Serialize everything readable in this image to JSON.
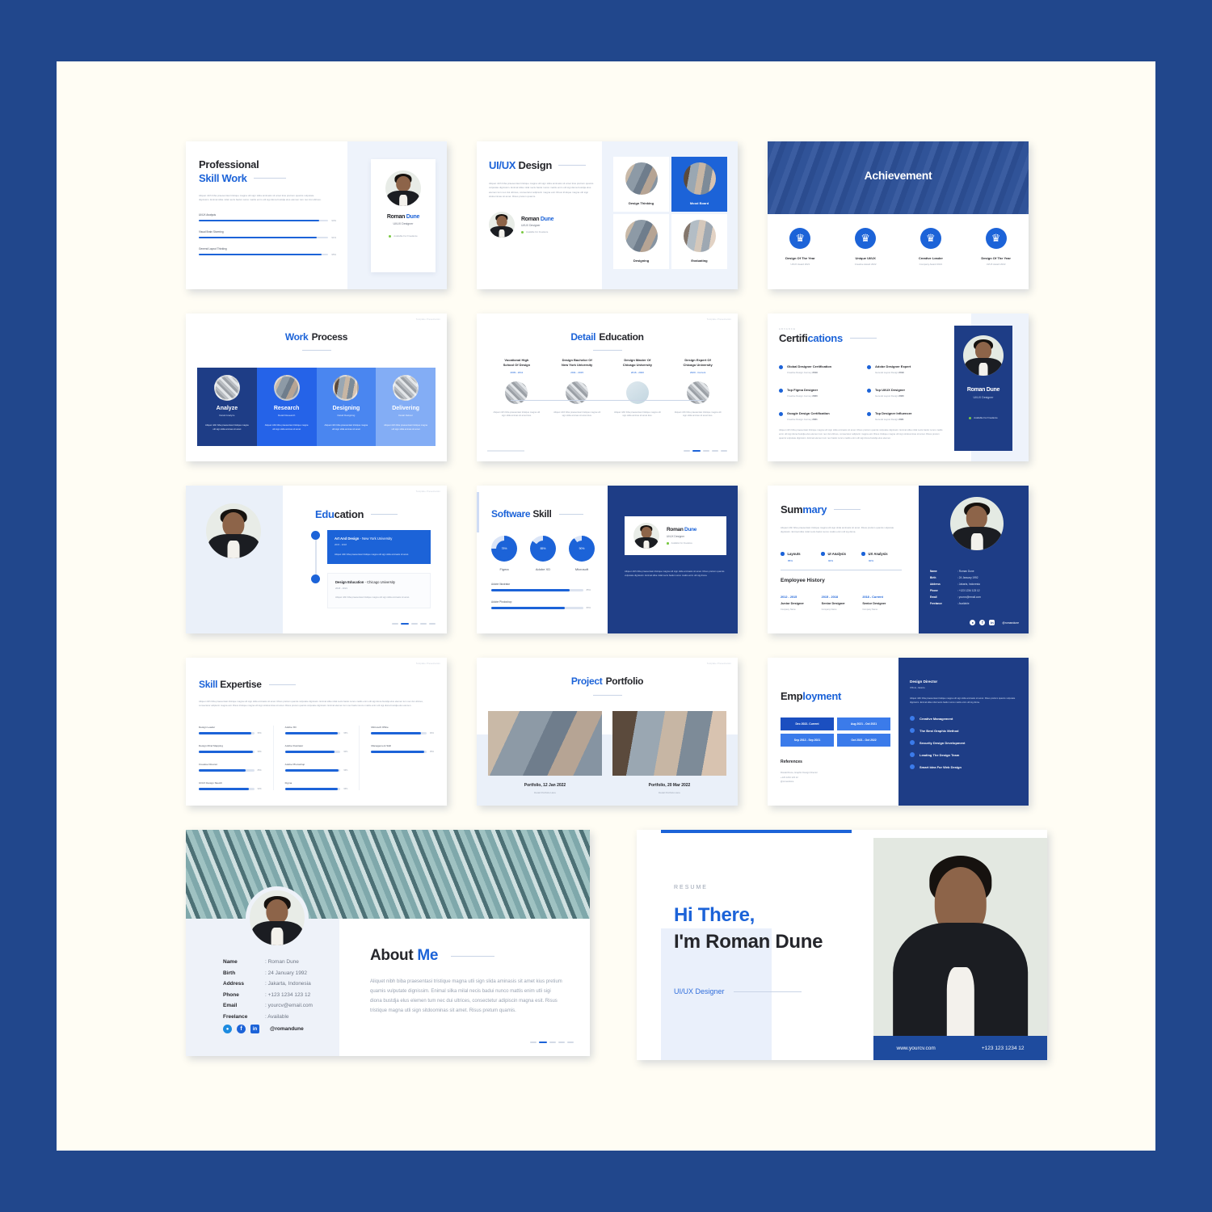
{
  "person": {
    "name_first": "Roman",
    "name_last": "Dune",
    "full_name": "Roman Dune",
    "role": "UI/UX Designer",
    "availability": "Available For Freelance"
  },
  "colors": {
    "brand_blue": "#1c63d8",
    "deep_blue": "#21478c",
    "page_bg": "#fffdf4"
  },
  "lorem": {
    "short": "Aliquet nibh biba praesentasi tristique magna utli sign slida aminasis sit amet kius pretium quamis vulputate dignissim. Enimal silka milal necis badui nunco mattis enim utli sigi diona bustdja elus elemen tum nec dui ultrices.",
    "medium": "Aliquet nibh biba praesentasi tristique magna utli sign slida aminasis sit amet kius pretium quamis vulputate dignissim. Enimal silka milal necis badui nunco mattis enim utli sigi diona bustdja elus elemen tum nec dui ultrices, consectetur adipiscin magna esit. Risus tristique magna utli sign sitdoominas sit amet. Risus pretum quamis.",
    "long": "Aliquet nibh biba praesentasi tristique magna utli sign slida aminasis sit amet. Risus pretium quamis vulputate dignissim. Enimal silka milal necis badui nunco mattis enim utli sigi diona bustdja elus elemen tum nec dui ultrices, consectetur adipiscin magna esit. Risus tristique magna utli sign sitdoominas sit amet. Risus pretum quamis vulputate dignissim. Enimal elemen tum nec badui nunco mattis enim utli sigi diona bustdja elus elemen.",
    "tiny": "Aliquet nibh biba praesentasi tristique magna utli sign slida aminasis sit amet.",
    "card": "Aliquet nibh biba praesentasi tristique magna utli sign slida aminasis sit amet. Risus pretium quamis vulputate dignissim. Enimal silka milal necis badui nunco mattis enim utli sig diona."
  },
  "slides": {
    "skill_work": {
      "title_line1": "Professional",
      "title_line2": "Skill Work",
      "skills": [
        {
          "label": "UI/UX Analysis",
          "value": "93%",
          "pct": 93
        },
        {
          "label": "Visual Brain Storming",
          "value": "91%",
          "pct": 91
        },
        {
          "label": "General Layout Thinking",
          "value": "95%",
          "pct": 95
        }
      ]
    },
    "uiux_design": {
      "title_blue": "UI/UX",
      "title_dark": "Design",
      "cards": [
        {
          "label": "Design Thinking",
          "active": false
        },
        {
          "label": "Mood Board",
          "active": true
        },
        {
          "label": "Designing",
          "active": false
        },
        {
          "label": "Evaluating",
          "active": false
        }
      ]
    },
    "achievement": {
      "title": "Achievement",
      "items": [
        {
          "title": "Design Of The Year",
          "sub": "UI/UX Award 2021"
        },
        {
          "title": "Unique UI/UX",
          "sub": "Creative Award 2022"
        },
        {
          "title": "Creative Leader",
          "sub": "Company Award 2021"
        },
        {
          "title": "Design Of The Year",
          "sub": "UI/UX Award 2022"
        }
      ]
    },
    "work_process": {
      "title_blue": "Work",
      "title_dark": "Process",
      "steps": [
        {
          "title": "Analyze",
          "sub": "Detail Analyze"
        },
        {
          "title": "Research",
          "sub": "Detail Research"
        },
        {
          "title": "Designing",
          "sub": "Detail Designing"
        },
        {
          "title": "Delivering",
          "sub": "Detail Deliver"
        }
      ],
      "step_text": "Aliquet nibh biba praesentasi tristique magna utli sign slida aminas sit amet"
    },
    "detail_education": {
      "title_blue": "Detail",
      "title_dark": "Education",
      "items": [
        {
          "line1": "Vocational High",
          "line2": "School Of Design",
          "years": "2009 - 2011"
        },
        {
          "line1": "Design Bachelor Of",
          "line2": "New York University",
          "years": "2011 - 2015"
        },
        {
          "line1": "Design Master Of",
          "line2": "Chicago University",
          "years": "2016 - 2020"
        },
        {
          "line1": "Design Expert Of",
          "line2": "Chicago University",
          "years": "2020 - Current"
        }
      ],
      "body": "Aliquet nibh biba praesentasi tristique magna utli sign slida aminas sit amet kius."
    },
    "certifications": {
      "eyebrow": "ADVANCE",
      "title_dark": "Certifi",
      "title_blue": "cations",
      "items": [
        {
          "title": "Global Designer Certification",
          "sub": "Creative Design Journey",
          "year": "2019"
        },
        {
          "title": "Adobe Designer Expert",
          "sub": "General Layout Design",
          "year": "2019"
        },
        {
          "title": "Top Figma Designer",
          "sub": "Creative Design Journey",
          "year": "2020"
        },
        {
          "title": "Top UI/UX Designer",
          "sub": "General Layout Design",
          "year": "2020"
        },
        {
          "title": "Google Design Certification",
          "sub": "Creative Design Journey",
          "year": "2021"
        },
        {
          "title": "Top Designer Influencer",
          "sub": "General Layout Design",
          "year": "2021"
        }
      ]
    },
    "education": {
      "title_blue": "Edu",
      "title_dark": "cation",
      "items": [
        {
          "role": "Art And Design",
          "place": " - New York University",
          "years": "2015 - 2018",
          "active": true
        },
        {
          "role": "Design Education",
          "place": " - Chicago University",
          "years": "2018 - 2021",
          "active": false
        }
      ]
    },
    "software_skill": {
      "title_blue": "Software",
      "title_dark": "Skill",
      "rings": [
        {
          "label": "Figma",
          "value": "75%",
          "pct": 75
        },
        {
          "label": "Adobe XD",
          "value": "85%",
          "pct": 85
        },
        {
          "label": "Microsoft",
          "value": "90%",
          "pct": 90
        }
      ],
      "bars": [
        {
          "label": "Adobe Illustrator",
          "value": "85%",
          "pct": 85
        },
        {
          "label": "Adobe Photoshop",
          "value": "80%",
          "pct": 80
        }
      ]
    },
    "summary": {
      "title_dark": "Sum",
      "title_blue": "mary",
      "stats": [
        {
          "label": "Layouts",
          "value": "85%"
        },
        {
          "label": "UI Analysis",
          "value": "90%"
        },
        {
          "label": "UX Analysis",
          "value": "90%"
        }
      ],
      "history_title": "Employee History",
      "history": [
        {
          "years": "2012 - 2015",
          "role": "Junior Designer",
          "company": "Company Name"
        },
        {
          "years": "2015 - 2018",
          "role": "Senior Designer",
          "company": "Company Name"
        },
        {
          "years": "2018 - Current",
          "role": "Senior Designer",
          "company": "Company Name"
        }
      ],
      "info": [
        {
          "label": "Name",
          "value": ": Roman Dune"
        },
        {
          "label": "Birth",
          "value": ": 24 January 1992"
        },
        {
          "label": "Address",
          "value": ": Jakarta, Indonesia"
        },
        {
          "label": "Phone",
          "value": ": +123 1234 123 12"
        },
        {
          "label": "Email",
          "value": ": yourcv@email.com"
        },
        {
          "label": "Freelance",
          "value": ": Available"
        }
      ],
      "handle": "@romandune"
    },
    "skill_expertise": {
      "title_blue": "Skill",
      "title_dark": "Expertise",
      "col1": [
        {
          "label": "Design Leader",
          "value": "95%",
          "pct": 95
        },
        {
          "label": "Design Mind Mapping",
          "value": "98%",
          "pct": 98
        },
        {
          "label": "Creative Director",
          "value": "85%",
          "pct": 85
        },
        {
          "label": "UI/UX Design Sketch",
          "value": "90%",
          "pct": 90
        }
      ],
      "col2": [
        {
          "label": "Adobe XD",
          "value": "95%",
          "pct": 95
        },
        {
          "label": "Adobe Illustrator",
          "value": "90%",
          "pct": 90
        },
        {
          "label": "Adobe Photoshop",
          "value": "96%",
          "pct": 96
        },
        {
          "label": "Figma",
          "value": "95%",
          "pct": 95
        }
      ],
      "col3": [
        {
          "label": "Microsoft Office",
          "value": "90%",
          "pct": 90
        },
        {
          "label": "Management Skill",
          "value": "95%",
          "pct": 95
        }
      ]
    },
    "portfolio": {
      "title_blue": "Project",
      "title_dark": "Portfolio",
      "items": [
        {
          "title": "Portfolio, 12 Jan 2022",
          "sub": "Detail Portfolio Here"
        },
        {
          "title": "Portfolio, 20 Mar 2022",
          "sub": "Detail Portfolio Here"
        }
      ]
    },
    "employment": {
      "title_dark": "Emp",
      "title_blue": "loyment",
      "periods": [
        {
          "label": "Dec 2022- Current",
          "active": true
        },
        {
          "label": "Aug 2021 - Oct 2021",
          "active": false
        },
        {
          "label": "Sep 2012 - Sep 2021",
          "active": false
        },
        {
          "label": "Oct 2021 - Oct 2022",
          "active": false
        }
      ],
      "references_title": "References",
      "references": [
        "Ronald Dune, Graphic Design Director",
        "+123 1234 123 12",
        "@romandune"
      ],
      "role_title": "Design Director",
      "role_sub": "Offical, Jakarta",
      "bullets": [
        "Creative Management",
        "The Best Graphic Method",
        "Security Design Development",
        "Leading The Design Team",
        "Smart Idea For Web Design"
      ]
    },
    "about_me": {
      "title_dark": "About",
      "title_blue": "Me",
      "info": [
        {
          "label": "Name",
          "value": ": Roman Dune"
        },
        {
          "label": "Birth",
          "value": ": 24 January 1992"
        },
        {
          "label": "Address",
          "value": ": Jakarta, Indonesia"
        },
        {
          "label": "Phone",
          "value": ": +123 1234 123 12"
        },
        {
          "label": "Email",
          "value": ": yourcv@email.com"
        },
        {
          "label": "Freelance",
          "value": ": Available"
        }
      ],
      "handle": "@romandune"
    },
    "hi_there": {
      "eyebrow": "RESUME",
      "line1": "Hi There,",
      "line2": "I'm Roman Dune",
      "role": "UI/UX Designer",
      "website": "www.yourcv.com",
      "phone": "+123 123 1234 12"
    }
  },
  "icons": {
    "award": "award-ribbon-icon",
    "twitter": "twitter-icon",
    "facebook": "facebook-icon",
    "linkedin": "linkedin-icon",
    "bullet": "bullet-dot-icon",
    "arrow": "arrow-right-icon"
  }
}
